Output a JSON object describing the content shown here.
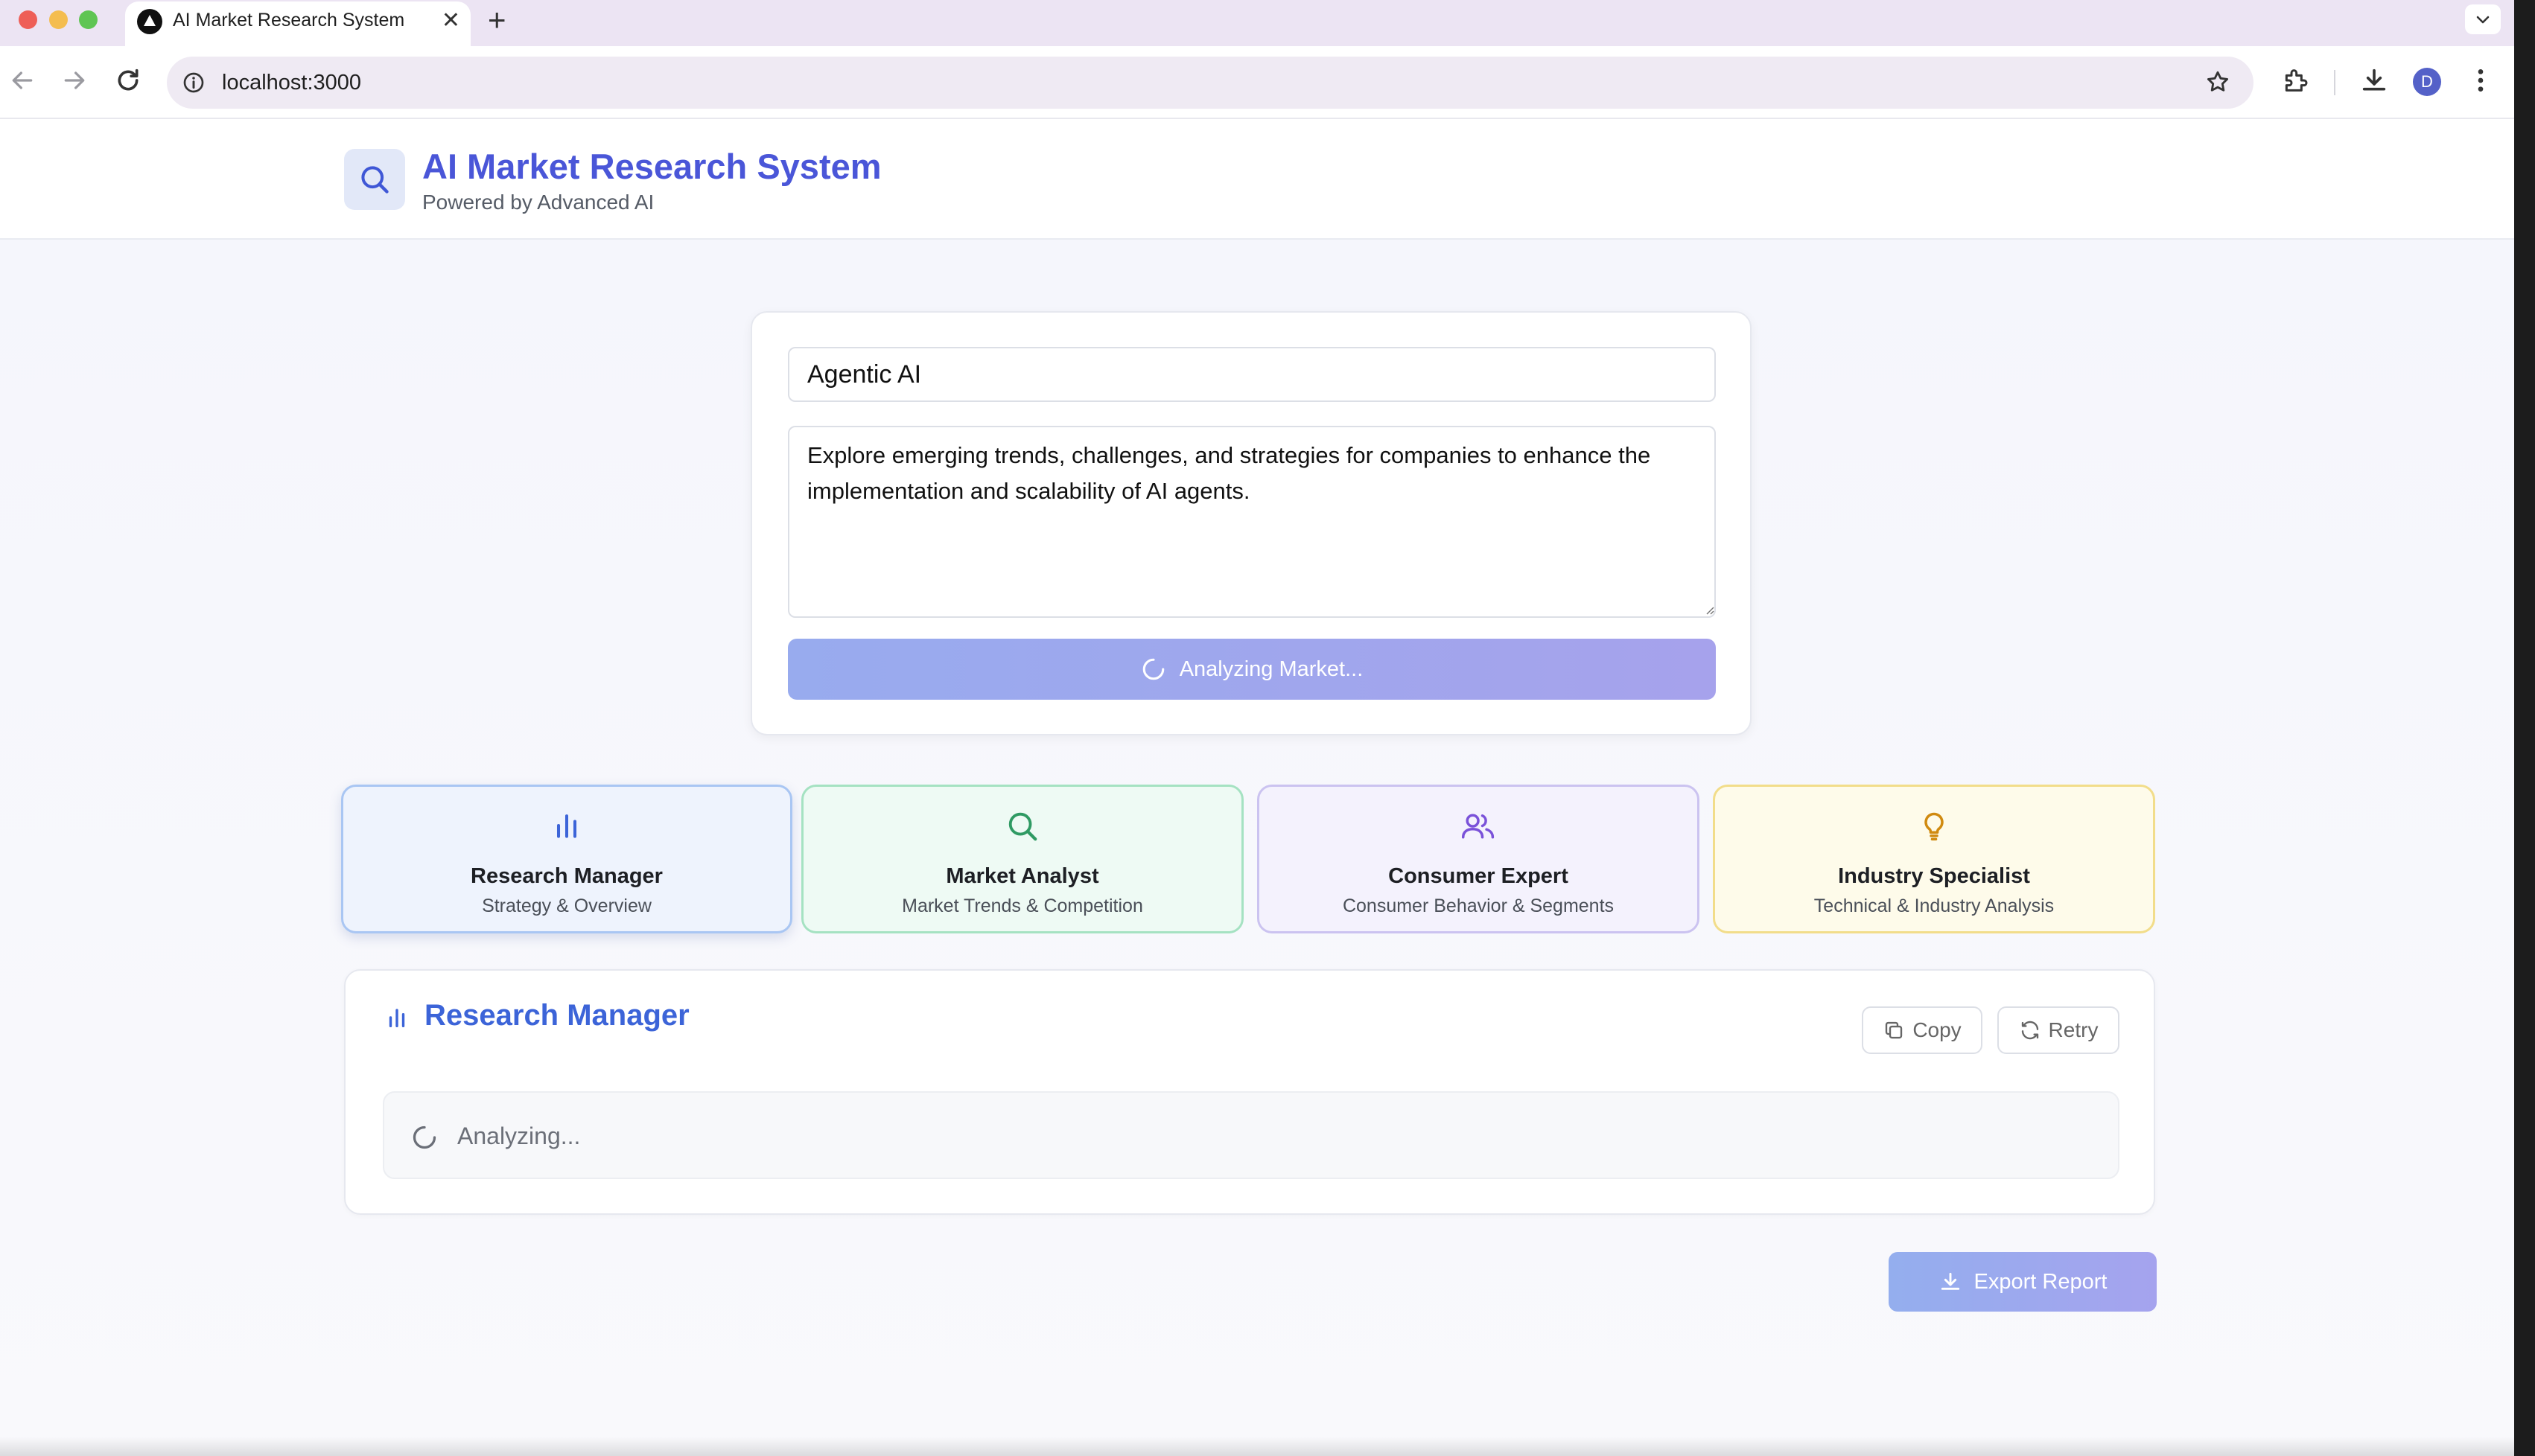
{
  "browser": {
    "tab_title": "AI Market Research System",
    "url": "localhost:3000",
    "avatar_initial": "D"
  },
  "header": {
    "title": "AI Market Research System",
    "subtitle": "Powered by Advanced AI"
  },
  "form": {
    "topic_value": "Agentic AI",
    "description_value": "Explore emerging trends, challenges, and strategies for companies to enhance the implementation and scalability of AI agents.",
    "analyze_button_label": "Analyzing Market..."
  },
  "agents": [
    {
      "name": "Research Manager",
      "description": "Strategy & Overview",
      "icon": "bar-chart-icon",
      "color": "#3c64d8",
      "selected": true
    },
    {
      "name": "Market Analyst",
      "description": "Market Trends & Competition",
      "icon": "search-icon",
      "color": "#2f9a63",
      "selected": false
    },
    {
      "name": "Consumer Expert",
      "description": "Consumer Behavior & Segments",
      "icon": "users-icon",
      "color": "#7a52d9",
      "selected": false
    },
    {
      "name": "Industry Specialist",
      "description": "Technical & Industry Analysis",
      "icon": "lightbulb-icon",
      "color": "#d08a10",
      "selected": false
    }
  ],
  "result": {
    "title": "Research Manager",
    "copy_label": "Copy",
    "retry_label": "Retry",
    "status_text": "Analyzing..."
  },
  "export": {
    "label": "Export Report"
  },
  "colors": {
    "brand": "#4a56d8",
    "accent_blue": "#3c64d8"
  }
}
